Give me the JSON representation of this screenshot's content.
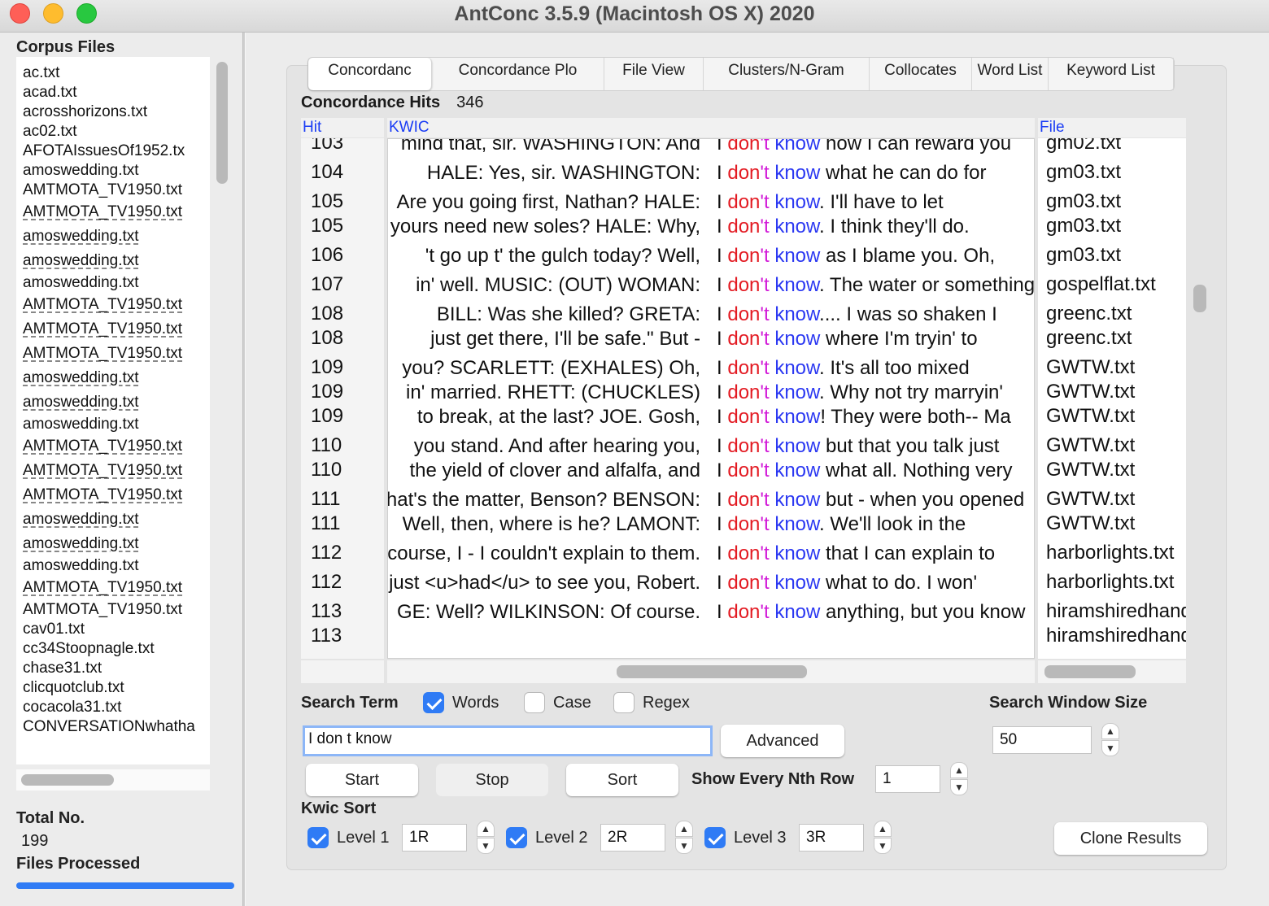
{
  "window": {
    "title": "AntConc 3.5.9 (Macintosh OS X) 2020"
  },
  "sidebar": {
    "corpus_label": "Corpus Files",
    "files": [
      {
        "name": "ac.txt",
        "dash": false
      },
      {
        "name": "acad.txt",
        "dash": false
      },
      {
        "name": "acrosshorizons.txt",
        "dash": false
      },
      {
        "name": "ac02.txt",
        "dash": false
      },
      {
        "name": "AFOTAIssuesOf1952.tx",
        "dash": false
      },
      {
        "name": "amoswedding.txt",
        "dash": false
      },
      {
        "name": "AMTMOTA_TV1950.txt",
        "dash": false
      },
      {
        "name": "AMTMOTA_TV1950.txt",
        "dash": true
      },
      {
        "name": "amoswedding.txt",
        "dash": true
      },
      {
        "name": "amoswedding.txt",
        "dash": true
      },
      {
        "name": "amoswedding.txt",
        "dash": false
      },
      {
        "name": "AMTMOTA_TV1950.txt",
        "dash": true
      },
      {
        "name": "AMTMOTA_TV1950.txt",
        "dash": true
      },
      {
        "name": "AMTMOTA_TV1950.txt",
        "dash": true
      },
      {
        "name": "amoswedding.txt",
        "dash": true
      },
      {
        "name": "amoswedding.txt",
        "dash": true
      },
      {
        "name": "amoswedding.txt",
        "dash": false
      },
      {
        "name": "AMTMOTA_TV1950.txt",
        "dash": true
      },
      {
        "name": "AMTMOTA_TV1950.txt",
        "dash": true
      },
      {
        "name": "AMTMOTA_TV1950.txt",
        "dash": true
      },
      {
        "name": "amoswedding.txt",
        "dash": true
      },
      {
        "name": "amoswedding.txt",
        "dash": true
      },
      {
        "name": "amoswedding.txt",
        "dash": false
      },
      {
        "name": "AMTMOTA_TV1950.txt",
        "dash": true
      },
      {
        "name": "AMTMOTA_TV1950.txt",
        "dash": false
      },
      {
        "name": "cav01.txt",
        "dash": false
      },
      {
        "name": "cc34Stoopnagle.txt",
        "dash": false
      },
      {
        "name": "chase31.txt",
        "dash": false
      },
      {
        "name": "clicquotclub.txt",
        "dash": false
      },
      {
        "name": "cocacola31.txt",
        "dash": false
      },
      {
        "name": "CONVERSATIONwhatha",
        "dash": false
      }
    ],
    "total_label": "Total No.",
    "total_value": "199",
    "processed_label": "Files Processed",
    "progress": 1.0
  },
  "tabs": [
    {
      "label": "Concordanc",
      "active": true
    },
    {
      "label": "Concordance Plo",
      "active": false
    },
    {
      "label": "File View",
      "active": false
    },
    {
      "label": "Clusters/N-Gram",
      "active": false
    },
    {
      "label": "Collocates",
      "active": false
    },
    {
      "label": "Word List",
      "active": false
    },
    {
      "label": "Keyword List",
      "active": false
    }
  ],
  "hits": {
    "label": "Concordance Hits",
    "count": "346"
  },
  "columns": {
    "hit": "Hit",
    "kwic": "KWIC",
    "file": "File"
  },
  "rows": [
    {
      "hit": "103",
      "left": "mind that, sir.  WASHINGTON: And",
      "right": " how I can reward you",
      "punct": "",
      "file": "gm02.txt"
    },
    {
      "hit": "104",
      "left": "HALE: Yes, sir.  WASHINGTON:",
      "right": " what he can do for",
      "punct": "",
      "file": "gm03.txt"
    },
    {
      "hit": "105",
      "left": "Are you going first, Nathan?  HALE:",
      "right": " I'll have to let",
      "punct": ".",
      "file": "gm03.txt"
    },
    {
      "hit": "105",
      "left": "yours need new soles?  HALE: Why,",
      "right": " I think they'll do.",
      "punct": ".",
      "file": "gm03.txt"
    },
    {
      "hit": "106",
      "left": "'t go up t' the gulch today?  Well,",
      "right": " as I blame you.  Oh,",
      "punct": "",
      "file": "gm03.txt"
    },
    {
      "hit": "107",
      "left": "in' well.  MUSIC: (OUT)  WOMAN:",
      "right": " The water or something",
      "punct": ".",
      "file": "gospelflat.txt"
    },
    {
      "hit": "108",
      "left": "BILL: Was she killed?   GRETA:",
      "right": "... I was so shaken I",
      "punct": ".",
      "file": "greenc.txt"
    },
    {
      "hit": "108",
      "left": "just get there, I'll be safe.\" But -",
      "right": " where I'm tryin'  to",
      "punct": "",
      "file": "greenc.txt"
    },
    {
      "hit": "109",
      "left": "you?  SCARLETT: (EXHALES) Oh,",
      "right": " It's all too mixed",
      "punct": ".",
      "file": "GWTW.txt"
    },
    {
      "hit": "109",
      "left": "in' married.  RHETT: (CHUCKLES)",
      "right": " Why not try marryin'",
      "punct": ".",
      "file": "GWTW.txt"
    },
    {
      "hit": "109",
      "left": "to break, at the  last?  JOE. Gosh,",
      "right": " They were both-- Ma",
      "punct": "!",
      "file": "GWTW.txt"
    },
    {
      "hit": "110",
      "left": "you stand. And after hearing you,",
      "right": " but that you talk just",
      "punct": "",
      "file": "GWTW.txt"
    },
    {
      "hit": "110",
      "left": "the yield of clover and alfalfa, and",
      "right": " what all. Nothing  very",
      "punct": "",
      "file": "GWTW.txt"
    },
    {
      "hit": "111",
      "left": "What's the matter, Benson?  BENSON:",
      "right": " but - when you opened",
      "punct": "",
      "file": "GWTW.txt"
    },
    {
      "hit": "111",
      "left": "Well, then, where is he?  LAMONT:",
      "right": " We'll look in the",
      "punct": ".",
      "file": "GWTW.txt"
    },
    {
      "hit": "112",
      "left": "course, I - I couldn't explain to  them.",
      "right": " that I can explain to",
      "punct": "",
      "file": "harborlights.txt"
    },
    {
      "hit": "112",
      "left": "just <u>had</u> to see you, Robert.",
      "right": " what  to do. I won'",
      "punct": "",
      "file": "harborlights.txt"
    },
    {
      "hit": "113",
      "left": "GE: Well?  WILKINSON: Of course.",
      "right": " anything, but you know",
      "punct": "",
      "file": "hiramshiredhand.txt"
    },
    {
      "hit": "113",
      "left": "",
      "right": "",
      "punct": "",
      "file": "hiramshiredhand.txt"
    }
  ],
  "kwic": {
    "i": "I ",
    "dont": "don",
    "apos": "'t ",
    "know": "know"
  },
  "search": {
    "term_label": "Search Term",
    "words_label": "Words",
    "words_checked": true,
    "case_label": "Case",
    "case_checked": false,
    "regex_label": "Regex",
    "regex_checked": false,
    "value": "I don t know",
    "advanced_label": "Advanced",
    "window_label": "Search Window Size",
    "window_value": "50"
  },
  "actions": {
    "start": "Start",
    "stop": "Stop",
    "sort": "Sort",
    "nth_label": "Show Every Nth Row",
    "nth_value": "1"
  },
  "kwic_sort": {
    "label": "Kwic Sort",
    "levels": [
      {
        "label": "Level 1",
        "value": "1R",
        "checked": true
      },
      {
        "label": "Level 2",
        "value": "2R",
        "checked": true
      },
      {
        "label": "Level 3",
        "value": "3R",
        "checked": true
      }
    ],
    "clone_label": "Clone Results"
  },
  "colors": {
    "accent": "#2f7bf5",
    "kw_dont": "#e31b23",
    "kw_t": "#d21bd8",
    "kw_know": "#2b38f2",
    "header_blue": "#1a3cf5"
  }
}
